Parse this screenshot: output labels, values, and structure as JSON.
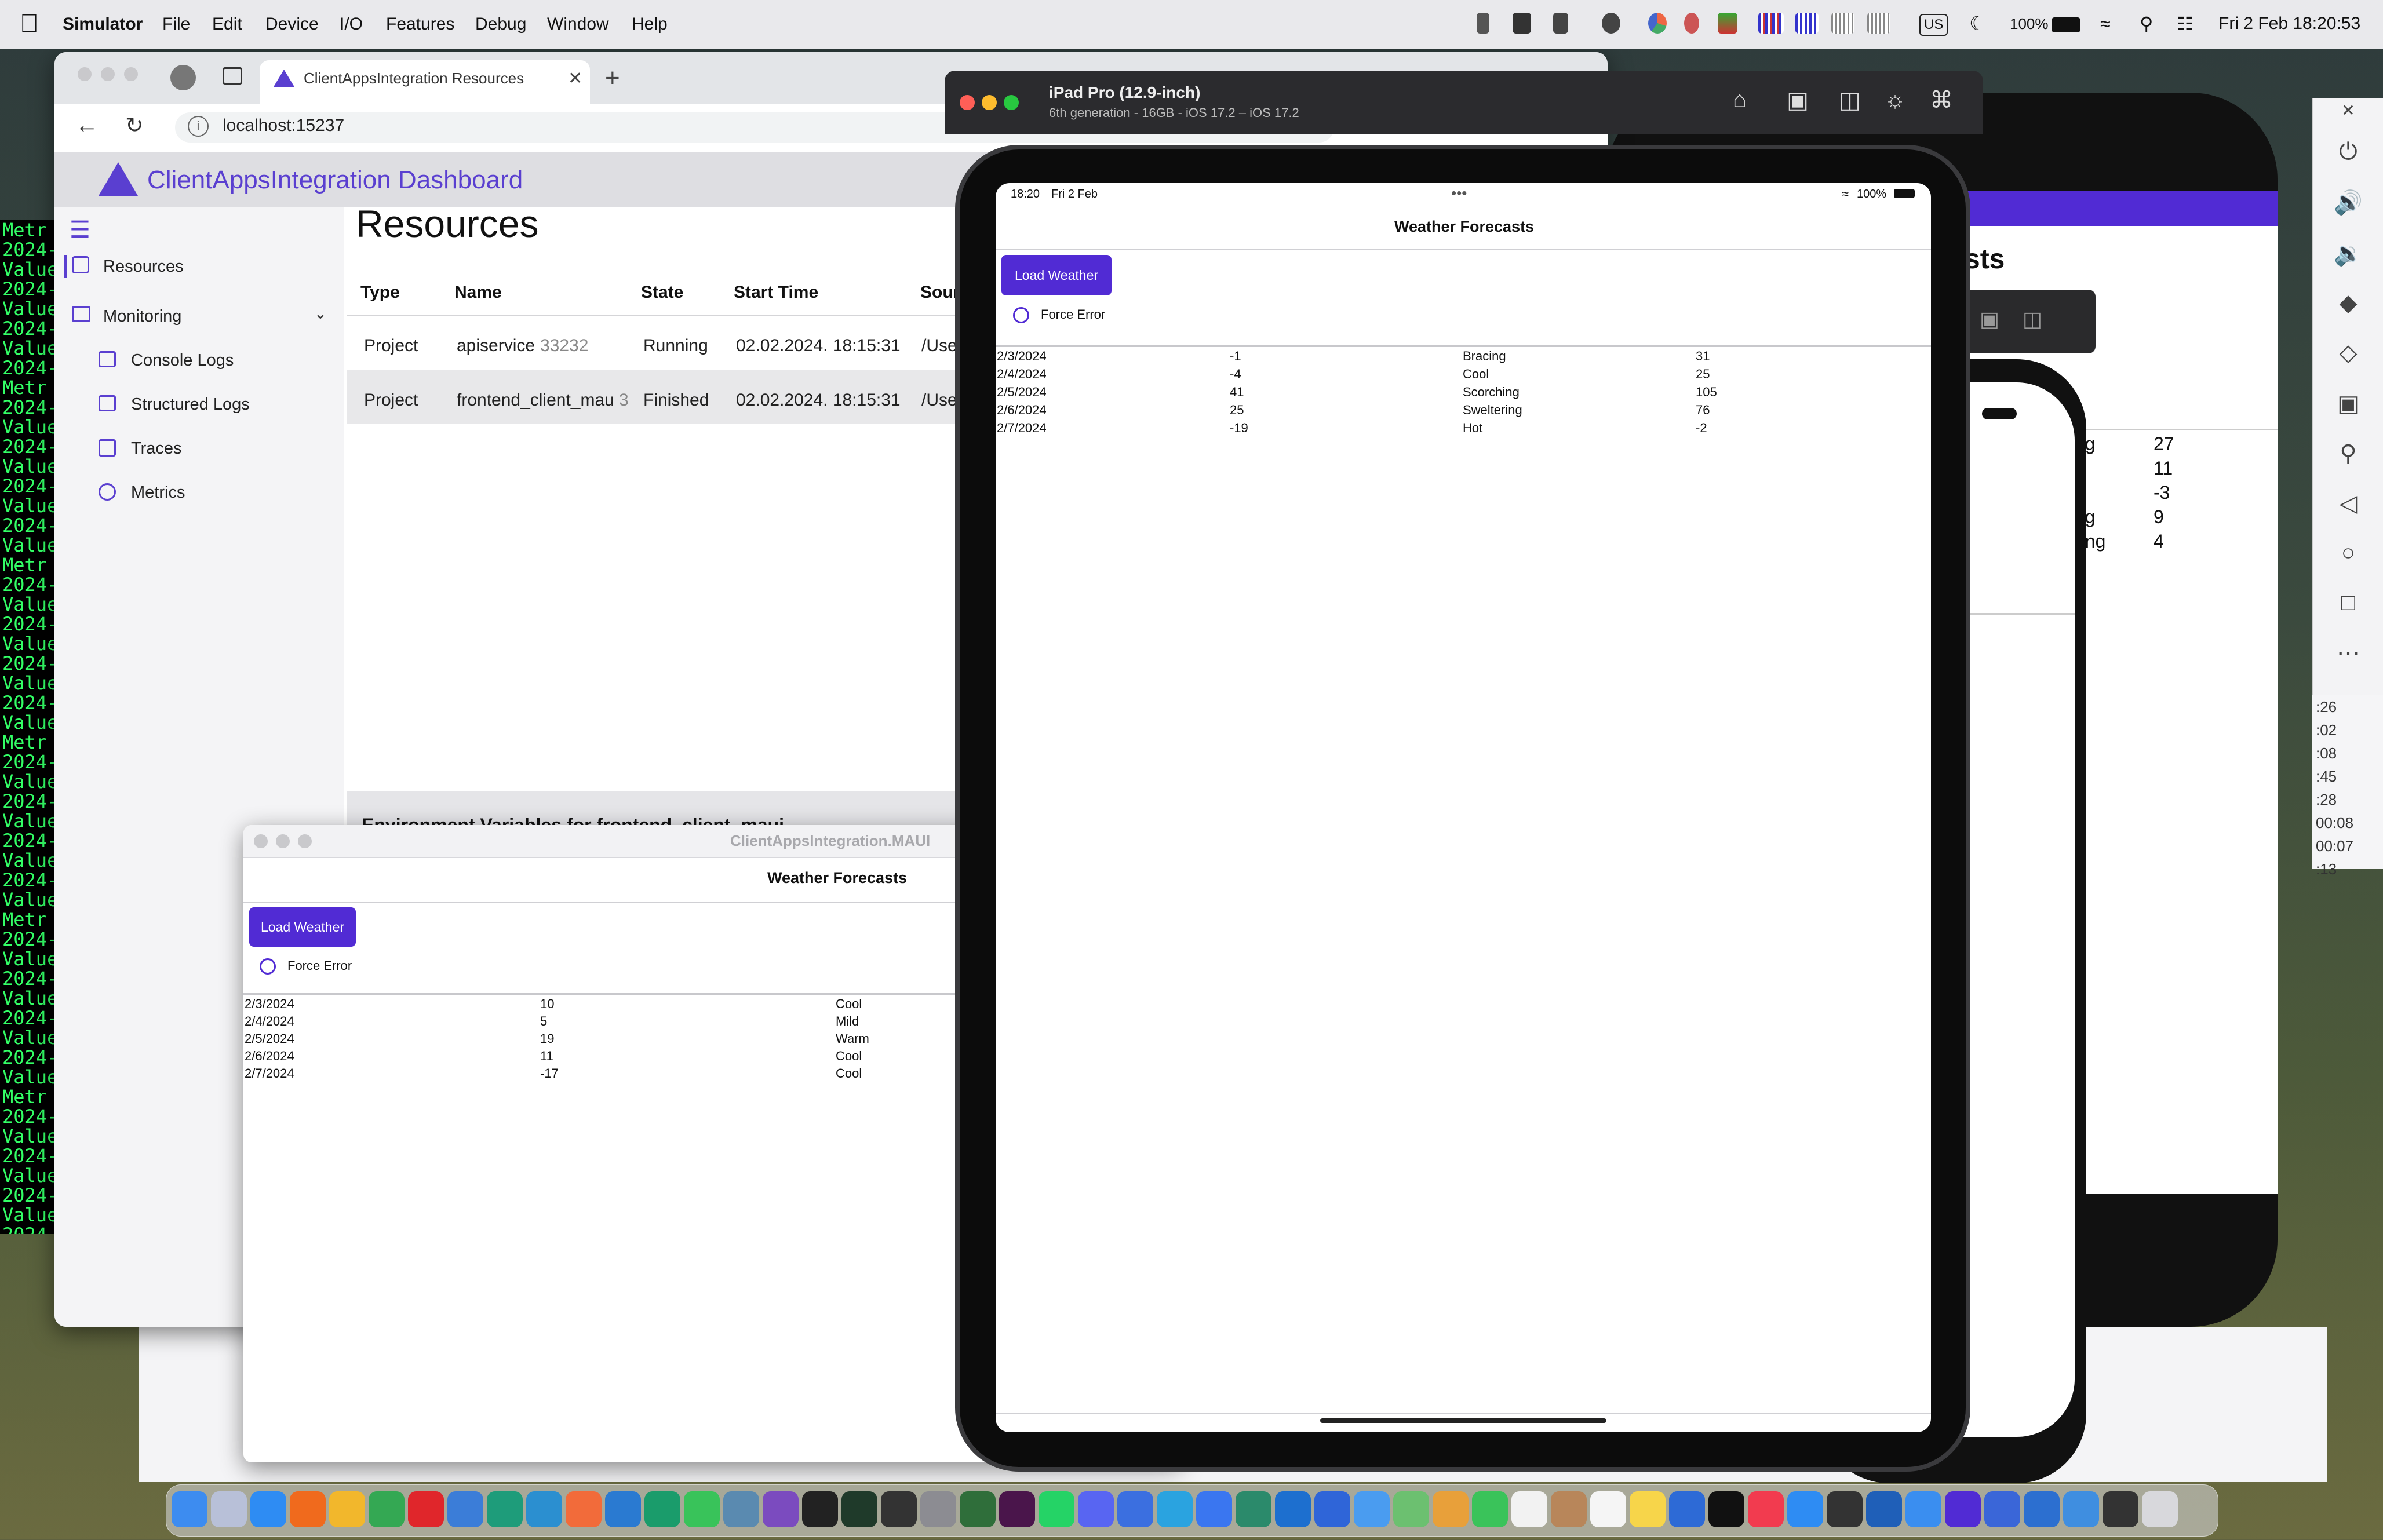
{
  "menubar": {
    "app": "Simulator",
    "items": [
      "File",
      "Edit",
      "Device",
      "I/O",
      "Features",
      "Debug",
      "Window",
      "Help"
    ],
    "battery": "100%",
    "keyboard": "US",
    "datetime": "Fri 2 Feb  18:20:53"
  },
  "terminal": {
    "lines": [
      "Metr",
      "2024-",
      "Value",
      "2024-",
      "Value",
      "2024-",
      "Value",
      "2024-",
      "Metr",
      "2024-",
      "Value",
      "2024-",
      "Value",
      "2024-",
      "Value",
      "2024-",
      "Value",
      "Metr",
      "2024-",
      "Value",
      "2024-",
      "Value",
      "2024-",
      "Value",
      "2024-",
      "Value",
      "Metr",
      "2024-",
      "Value",
      "2024-",
      "Value",
      "2024-",
      "Value",
      "2024-",
      "Value",
      "Metr",
      "2024-",
      "Value",
      "2024-",
      "Value",
      "2024-",
      "Value",
      "2024-",
      "Value",
      "Metr",
      "2024-",
      "Value",
      "2024-",
      "Value",
      "2024-",
      "Value",
      "2024-",
      "Value"
    ]
  },
  "browser": {
    "tab_title": "ClientAppsIntegration Resources",
    "url": "localhost:15237",
    "dashboard_title": "ClientAppsIntegration Dashboard",
    "nav": {
      "resources": "Resources",
      "monitoring": "Monitoring",
      "console_logs": "Console Logs",
      "structured_logs": "Structured Logs",
      "traces": "Traces",
      "metrics": "Metrics"
    },
    "page_title": "Resources",
    "columns": [
      "Type",
      "Name",
      "State",
      "Start Time",
      "Sour"
    ],
    "rows": [
      {
        "type": "Project",
        "name": "apiservice",
        "pid": "33232",
        "state": "Running",
        "start": "02.02.2024. 18:15:31",
        "source": "/Use"
      },
      {
        "type": "Project",
        "name": "frontend_client_maui",
        "pid": "3",
        "state": "Finished",
        "start": "02.02.2024. 18:15:31",
        "source": "/Use"
      }
    ],
    "env_panel_title": "Environment Variables for frontend_client_maui"
  },
  "maui_window": {
    "title": "ClientAppsIntegration.MAUI",
    "page_title": "Weather Forecasts",
    "load_button": "Load Weather",
    "force_error": "Force Error",
    "forecasts": [
      {
        "date": "2/3/2024",
        "temp": "10",
        "summary": "Cool"
      },
      {
        "date": "2/4/2024",
        "temp": "5",
        "summary": "Mild"
      },
      {
        "date": "2/5/2024",
        "temp": "19",
        "summary": "Warm"
      },
      {
        "date": "2/6/2024",
        "temp": "11",
        "summary": "Cool"
      },
      {
        "date": "2/7/2024",
        "temp": "-17",
        "summary": "Cool"
      }
    ]
  },
  "simulator": {
    "device": "iPad Pro (12.9-inch)",
    "subtitle": "6th generation - 16GB - iOS 17.2 – iOS 17.2",
    "status_time": "18:20",
    "status_date": "Fri 2 Feb",
    "status_battery": "100%",
    "page_title": "Weather Forecasts",
    "load_button": "Load Weather",
    "force_error": "Force Error",
    "forecasts": [
      {
        "date": "2/3/2024",
        "temp_c": "-1",
        "summary": "Bracing",
        "temp_f": "31"
      },
      {
        "date": "2/4/2024",
        "temp_c": "-4",
        "summary": "Cool",
        "temp_f": "25"
      },
      {
        "date": "2/5/2024",
        "temp_c": "41",
        "summary": "Scorching",
        "temp_f": "105"
      },
      {
        "date": "2/6/2024",
        "temp_c": "25",
        "summary": "Sweltering",
        "temp_f": "76"
      },
      {
        "date": "2/7/2024",
        "temp_c": "-19",
        "summary": "Hot",
        "temp_f": "-2"
      }
    ]
  },
  "android": {
    "title_fragment": "sts",
    "summaries": [
      "ng",
      "g",
      "",
      "ng",
      "ring"
    ],
    "values": [
      "27",
      "11",
      "-3",
      "9",
      "4"
    ],
    "side_times": [
      ":26",
      ":02",
      ":08",
      ":45",
      ":28",
      "00:08",
      "00:07",
      ":13"
    ]
  },
  "colors": {
    "accent": "#512bd4",
    "dashboard_accent": "#5a3fd0",
    "terminal_text": "#33ff66"
  }
}
